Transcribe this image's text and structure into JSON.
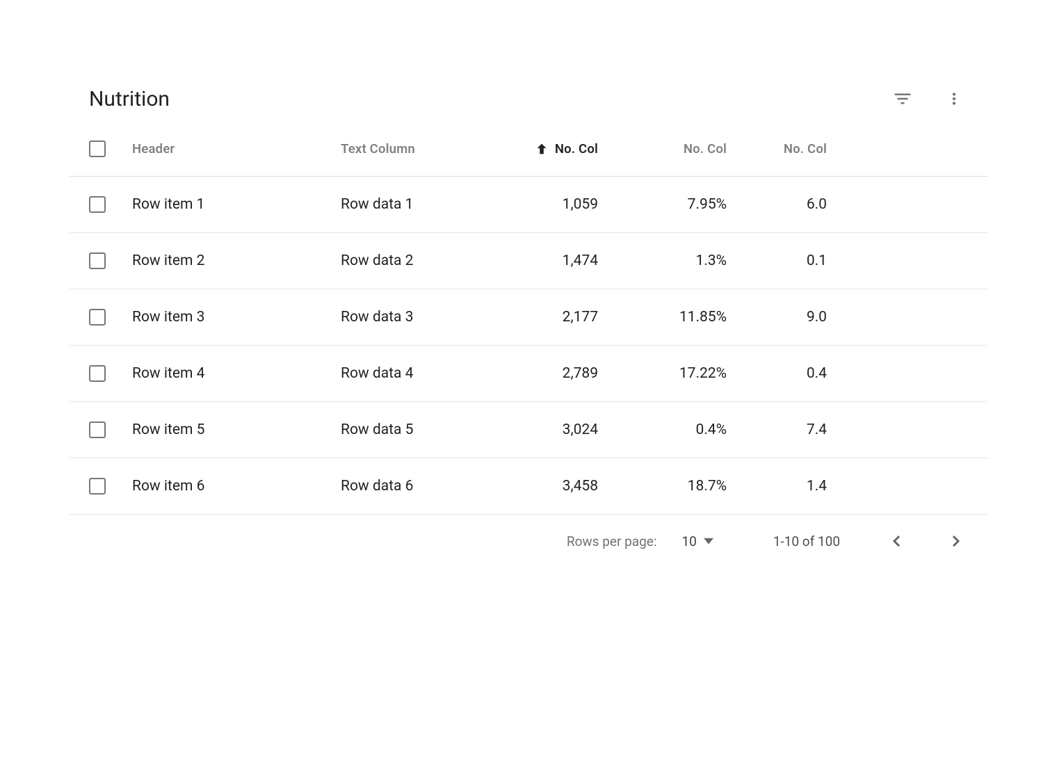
{
  "toolbar": {
    "title": "Nutrition"
  },
  "columns": {
    "header": "Header",
    "text": "Text Column",
    "num1": "No. Col",
    "num2": "No. Col",
    "num3": "No. Col"
  },
  "rows": [
    {
      "header": "Row item 1",
      "text": "Row data 1",
      "num1": "1,059",
      "num2": "7.95%",
      "num3": "6.0"
    },
    {
      "header": "Row item 2",
      "text": "Row data 2",
      "num1": "1,474",
      "num2": "1.3%",
      "num3": "0.1"
    },
    {
      "header": "Row item 3",
      "text": "Row data 3",
      "num1": "2,177",
      "num2": "11.85%",
      "num3": "9.0"
    },
    {
      "header": "Row item 4",
      "text": "Row data 4",
      "num1": "2,789",
      "num2": "17.22%",
      "num3": "0.4"
    },
    {
      "header": "Row item 5",
      "text": "Row data 5",
      "num1": "3,024",
      "num2": "0.4%",
      "num3": "7.4"
    },
    {
      "header": "Row item 6",
      "text": "Row data 6",
      "num1": "3,458",
      "num2": "18.7%",
      "num3": "1.4"
    }
  ],
  "pagination": {
    "label": "Rows per page:",
    "size": "10",
    "range": "1-10 of 100"
  }
}
